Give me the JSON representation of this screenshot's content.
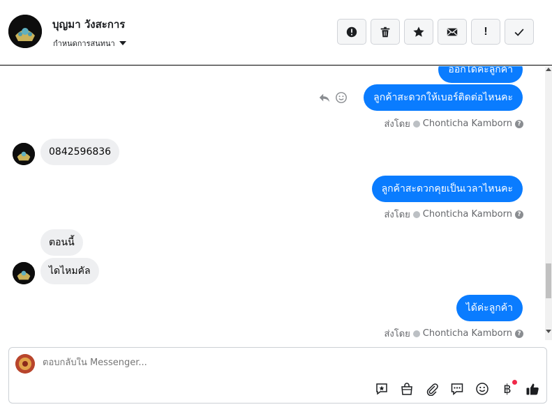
{
  "header": {
    "contact_name": "บุญมา วังสะการ",
    "assign_label": "กำหนดการสนทนา",
    "actions": [
      {
        "name": "report-spam",
        "icon": "alert-circle-icon"
      },
      {
        "name": "delete",
        "icon": "trash-icon"
      },
      {
        "name": "star",
        "icon": "star-icon"
      },
      {
        "name": "mark-unread",
        "icon": "envelope-icon"
      },
      {
        "name": "follow-up",
        "icon": "exclamation-icon"
      },
      {
        "name": "mark-done",
        "icon": "check-icon"
      }
    ]
  },
  "messages": [
    {
      "dir": "out",
      "text": "ออกได้ค่ะลูกค้า"
    },
    {
      "dir": "out",
      "text": "ลูกค้าสะดวกให้เบอร์ติดต่อไหนคะ"
    },
    {
      "dir": "meta",
      "text_prefix": "ส่งโดย",
      "agent": "Chonticha Kamborn"
    },
    {
      "dir": "in",
      "text": "0842596836"
    },
    {
      "dir": "out",
      "text": "ลูกค้าสะดวกคุยเป็นเวลาไหนคะ"
    },
    {
      "dir": "meta",
      "text_prefix": "ส่งโดย",
      "agent": "Chonticha Kamborn"
    },
    {
      "dir": "in",
      "text": "ตอนนี้"
    },
    {
      "dir": "in",
      "text": "ไดไหมคัล"
    },
    {
      "dir": "out",
      "text": "ได้ค่ะลูกค้า"
    },
    {
      "dir": "meta",
      "text_prefix": "ส่งโดย",
      "agent": "Chonticha Kamborn"
    }
  ],
  "composer": {
    "placeholder": "ตอบกลับใน Messenger...",
    "tools": [
      "saved-reply-icon",
      "shop-bag-icon",
      "paperclip-icon",
      "chat-bubble-icon",
      "emoji-icon",
      "baht-icon",
      "thumbs-up-icon"
    ],
    "baht_symbol": "฿"
  },
  "colors": {
    "outgoing_bubble": "#0a7cff",
    "incoming_bubble": "#eeeff1",
    "meta_text": "#65676b",
    "notification_dot": "#f02849"
  }
}
